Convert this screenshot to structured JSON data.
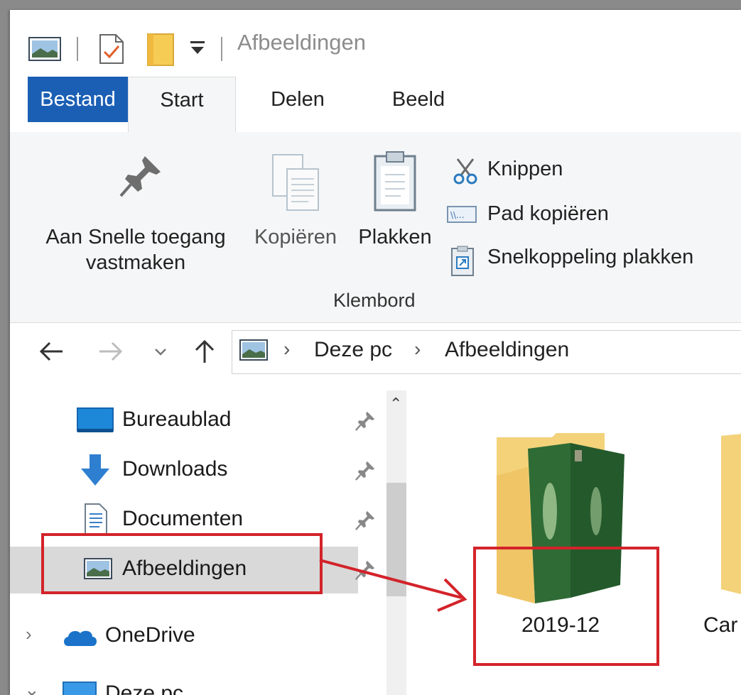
{
  "titlebar": {
    "title": "Afbeeldingen",
    "quick_access_icons": [
      "pictures-icon",
      "properties-icon",
      "new-folder-icon",
      "customize-dropdown-icon"
    ]
  },
  "tabs": [
    {
      "label": "Bestand"
    },
    {
      "label": "Start"
    },
    {
      "label": "Delen"
    },
    {
      "label": "Beeld"
    }
  ],
  "ribbon": {
    "pin_label_1": "Aan Snelle toegang",
    "pin_label_2": "vastmaken",
    "copy_label": "Kopiëren",
    "paste_label": "Plakken",
    "cut_label": "Knippen",
    "copy_path_label": "Pad kopiëren",
    "paste_shortcut_label": "Snelkoppeling plakken",
    "group_label": "Klembord"
  },
  "address": {
    "crumbs": [
      "Deze pc",
      "Afbeeldingen"
    ]
  },
  "nav": {
    "items": [
      {
        "label": "Bureaublad",
        "icon": "desktop-icon"
      },
      {
        "label": "Downloads",
        "icon": "downloads-icon"
      },
      {
        "label": "Documenten",
        "icon": "documents-icon"
      },
      {
        "label": "Afbeeldingen",
        "icon": "pictures-icon",
        "selected": true
      },
      {
        "label": "OneDrive",
        "icon": "onedrive-icon"
      },
      {
        "label": "Deze pc",
        "icon": "this-pc-icon"
      }
    ]
  },
  "content": {
    "folders": [
      {
        "label": "2019-12"
      },
      {
        "label": "Car"
      }
    ]
  },
  "colors": {
    "file_tab": "#1a5fb4",
    "annotation": "#d3232a",
    "folder": "#f3d27a",
    "selection": "#d9d9d9"
  }
}
